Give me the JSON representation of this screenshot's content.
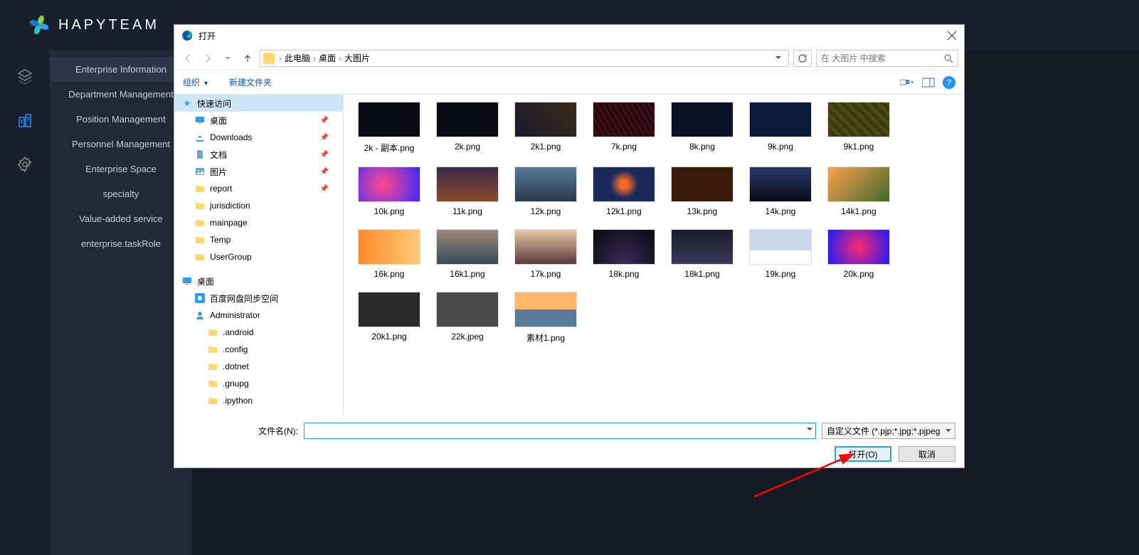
{
  "app": {
    "logo_text": "HAPYTEAM",
    "menu": [
      "Enterprise Information",
      "Department Management",
      "Position Management",
      "Personnel Management",
      "Enterprise Space",
      "specialty",
      "Value-added service",
      "enterprise.taskRole"
    ]
  },
  "dialog": {
    "title": "打开",
    "breadcrumbs": [
      "此电脑",
      "桌面",
      "大图片"
    ],
    "search_placeholder": "在 大图片 中搜索",
    "toolbar": {
      "organize": "组织",
      "new_folder": "新建文件夹"
    },
    "tree": {
      "quick_access": "快速访问",
      "desktop": "桌面",
      "downloads": "Downloads",
      "documents": "文档",
      "pictures": "图片",
      "report": "report",
      "jurisdiction": "jurisdiction",
      "mainpage": "mainpage",
      "temp": "Temp",
      "usergroup": "UserGroup",
      "desktop2": "桌面",
      "baidu": "百度网盘同步空间",
      "admin": "Administrator",
      "android": ".android",
      "config": ".config",
      "dotnet": ".dotnet",
      "gnupg": ".gnupg",
      "ipython": ".ipython"
    },
    "files": [
      {
        "name": "2k - 副本.png",
        "t": 0
      },
      {
        "name": "2k.png",
        "t": 1
      },
      {
        "name": "2k1.png",
        "t": 2
      },
      {
        "name": "7k.png",
        "t": 3
      },
      {
        "name": "8k.png",
        "t": 4
      },
      {
        "name": "9k.png",
        "t": 5
      },
      {
        "name": "9k1.png",
        "t": 6
      },
      {
        "name": "10k.png",
        "t": 7
      },
      {
        "name": "11k.png",
        "t": 8
      },
      {
        "name": "12k.png",
        "t": 9
      },
      {
        "name": "12k1.png",
        "t": 10
      },
      {
        "name": "13k.png",
        "t": 11
      },
      {
        "name": "14k.png",
        "t": 12
      },
      {
        "name": "14k1.png",
        "t": 13
      },
      {
        "name": "16k.png",
        "t": 14
      },
      {
        "name": "16k1.png",
        "t": 15
      },
      {
        "name": "17k.png",
        "t": 16
      },
      {
        "name": "18k.png",
        "t": 17
      },
      {
        "name": "18k1.png",
        "t": 18
      },
      {
        "name": "19k.png",
        "t": 19
      },
      {
        "name": "20k.png",
        "t": 20
      },
      {
        "name": "20k1.png",
        "t": 21
      },
      {
        "name": "22k.jpeg",
        "t": 22
      },
      {
        "name": "素材1.png",
        "t": 23
      }
    ],
    "footer": {
      "filename_label": "文件名(N):",
      "filename_value": "",
      "filetype": "自定义文件 (*.pjp;*.jpg;*.pjpeg",
      "open_btn": "打开(O)",
      "cancel_btn": "取消"
    },
    "help_glyph": "?"
  }
}
